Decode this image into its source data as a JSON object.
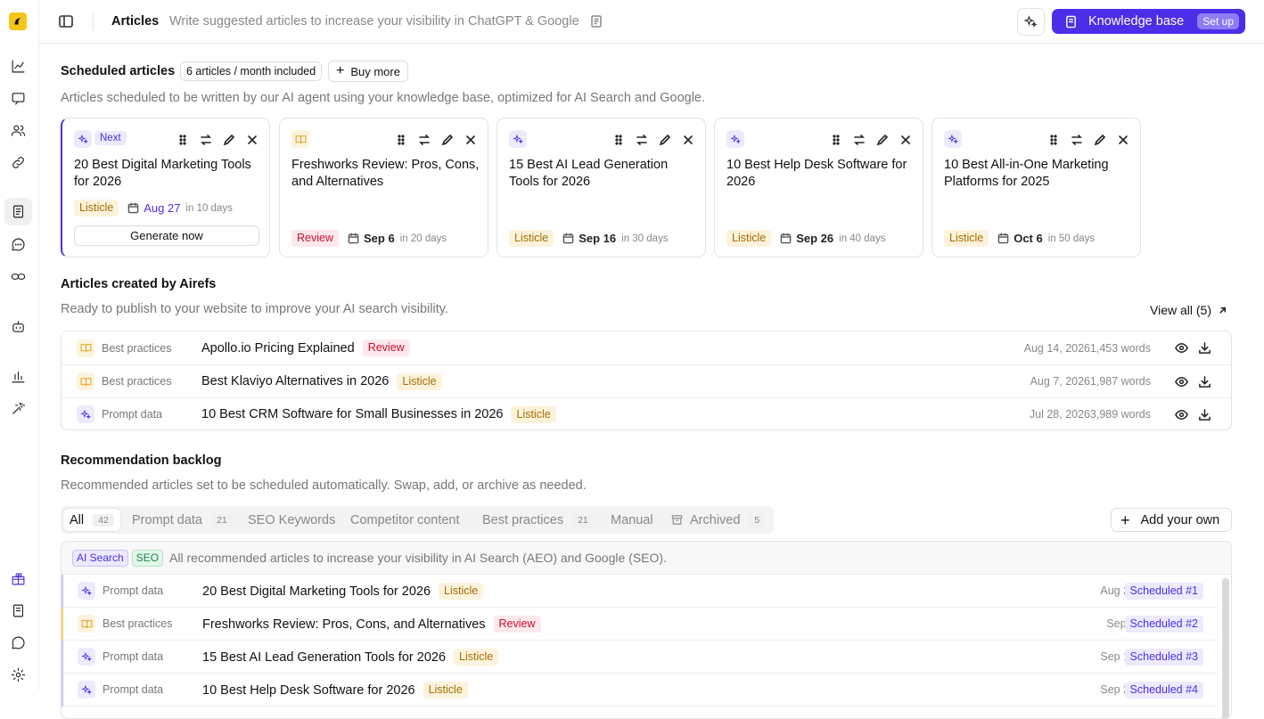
{
  "topbar": {
    "title": "Articles",
    "subtitle": "Write suggested articles to increase your visibility in ChatGPT & Google",
    "kb_label": "Knowledge base",
    "kb_badge": "Set up"
  },
  "scheduled": {
    "heading": "Scheduled articles",
    "included": "6 articles / month included",
    "buy_more": "Buy more",
    "description": "Articles scheduled to be written by our AI agent using your knowledge base, optimized for AI Search and Google.",
    "cards": [
      {
        "source": "prompt-data",
        "next_label": "Next",
        "title": "20 Best Digital Marketing Tools for 2026",
        "tag": "Listicle",
        "date": "Aug 27",
        "in": "in 10 days",
        "action": "Generate now"
      },
      {
        "source": "best-practices",
        "title": "Freshworks Review: Pros, Cons, and Alternatives",
        "tag": "Review",
        "date": "Sep 6",
        "in": "in 20 days"
      },
      {
        "source": "prompt-data",
        "title": "15 Best AI Lead Generation Tools for 2026",
        "tag": "Listicle",
        "date": "Sep 16",
        "in": "in 30 days"
      },
      {
        "source": "prompt-data",
        "title": "10 Best Help Desk Software for 2026",
        "tag": "Listicle",
        "date": "Sep 26",
        "in": "in 40 days"
      },
      {
        "source": "prompt-data",
        "title": "10 Best All-in-One Marketing Platforms for 2025",
        "tag": "Listicle",
        "date": "Oct 6",
        "in": "in 50 days"
      }
    ]
  },
  "created": {
    "heading": "Articles created by Airefs",
    "description": "Ready to publish to your website to improve your AI search visibility.",
    "view_all": "View all (5)",
    "rows": [
      {
        "source": "Best practices",
        "title": "Apollo.io Pricing Explained",
        "tag": "Review",
        "date": "Aug 14, 2026",
        "words": "1,453 words"
      },
      {
        "source": "Best practices",
        "title": "Best Klaviyo Alternatives in 2026",
        "tag": "Listicle",
        "date": "Aug 7, 2026",
        "words": "1,987 words"
      },
      {
        "source": "Prompt data",
        "title": "10 Best CRM Software for Small Businesses in 2026",
        "tag": "Listicle",
        "date": "Jul 28, 2026",
        "words": "3,989 words"
      }
    ]
  },
  "backlog": {
    "heading": "Recommendation backlog",
    "description": "Recommended articles set to be scheduled automatically. Swap, add, or archive as needed.",
    "tabs": [
      {
        "label": "All",
        "count": "42"
      },
      {
        "label": "Prompt data",
        "count": "21"
      },
      {
        "label": "SEO Keywords"
      },
      {
        "label": "Competitor content"
      },
      {
        "label": "Best practices",
        "count": "21"
      },
      {
        "label": "Manual"
      },
      {
        "label": "Archived",
        "count": "5"
      }
    ],
    "add_own": "Add your own",
    "head_tags": [
      "AI Search",
      "SEO"
    ],
    "head_text": "All recommended articles to increase your visibility in AI Search (AEO) and Google (SEO).",
    "rows": [
      {
        "source": "Prompt data",
        "title": "20 Best Digital Marketing Tools for 2026",
        "tag": "Listicle",
        "date": "Aug 27",
        "status": "Scheduled #1"
      },
      {
        "source": "Best practices",
        "title": "Freshworks Review: Pros, Cons, and Alternatives",
        "tag": "Review",
        "date": "Sep 6",
        "status": "Scheduled #2"
      },
      {
        "source": "Prompt data",
        "title": "15 Best AI Lead Generation Tools for 2026",
        "tag": "Listicle",
        "date": "Sep 16",
        "status": "Scheduled #3"
      },
      {
        "source": "Prompt data",
        "title": "10 Best Help Desk Software for 2026",
        "tag": "Listicle",
        "date": "Sep 26",
        "status": "Scheduled #4"
      }
    ]
  },
  "colors": {
    "accent": "#4a2ee8",
    "listicle": "#a56d00",
    "review": "#c8102e",
    "logo": "#f5c518"
  }
}
